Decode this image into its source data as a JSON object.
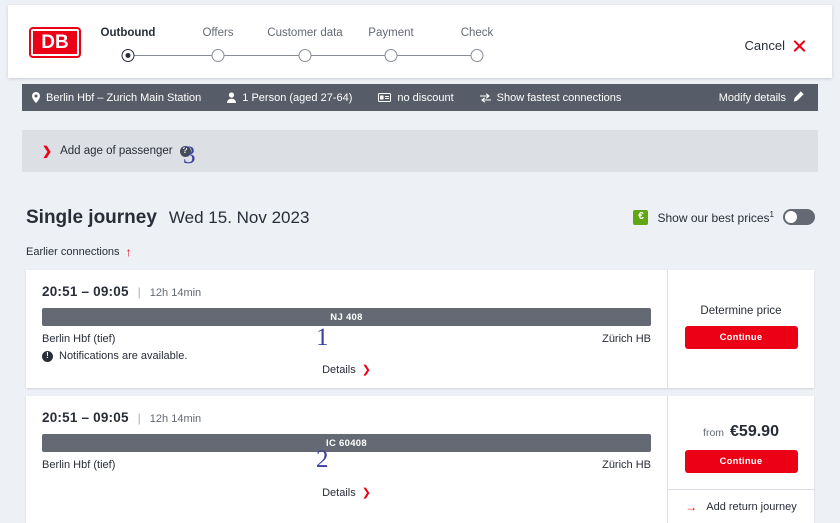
{
  "brand": {
    "logo_text": "DB",
    "primary_color": "#ec0016",
    "dark_color": "#282d37"
  },
  "header": {
    "steps": [
      {
        "label": "Outbound",
        "active": true
      },
      {
        "label": "Offers",
        "active": false
      },
      {
        "label": "Customer data",
        "active": false
      },
      {
        "label": "Payment",
        "active": false
      },
      {
        "label": "Check",
        "active": false
      }
    ],
    "cancel_label": "Cancel"
  },
  "info_bar": {
    "route": "Berlin Hbf – Zurich Main Station",
    "passengers": "1 Person (aged 27-64)",
    "discount": "no discount",
    "connections": "Show fastest connections",
    "modify_label": "Modify details"
  },
  "age_panel": {
    "label": "Add age of passenger",
    "help_glyph": "?"
  },
  "journey": {
    "title": "Single journey",
    "date": "Wed 15. Nov 2023",
    "best_prices_label": "Show our best prices",
    "best_prices_sup": "1",
    "best_prices_toggle": "off",
    "euro_glyph": "€",
    "earlier_connections": "Earlier connections"
  },
  "cards": [
    {
      "times": "20:51 – 09:05",
      "separator": "|",
      "duration": "12h 14min",
      "train": "NJ 408",
      "origin": "Berlin Hbf (tief)",
      "destination": "Zürich HB",
      "notification": "Notifications are available.",
      "details_label": "Details",
      "price_note": "Determine price",
      "continue_label": "Continue"
    },
    {
      "times": "20:51 – 09:05",
      "separator": "|",
      "duration": "12h 14min",
      "train": "IC 60408",
      "origin": "Berlin Hbf (tief)",
      "destination": "Zürich HB",
      "details_label": "Details",
      "price_from": "from",
      "price_value": "€59.90",
      "continue_label": "Continue",
      "return_label": "Add return journey"
    }
  ],
  "annotations": [
    {
      "number": "1"
    },
    {
      "number": "2"
    },
    {
      "number": "3"
    }
  ]
}
